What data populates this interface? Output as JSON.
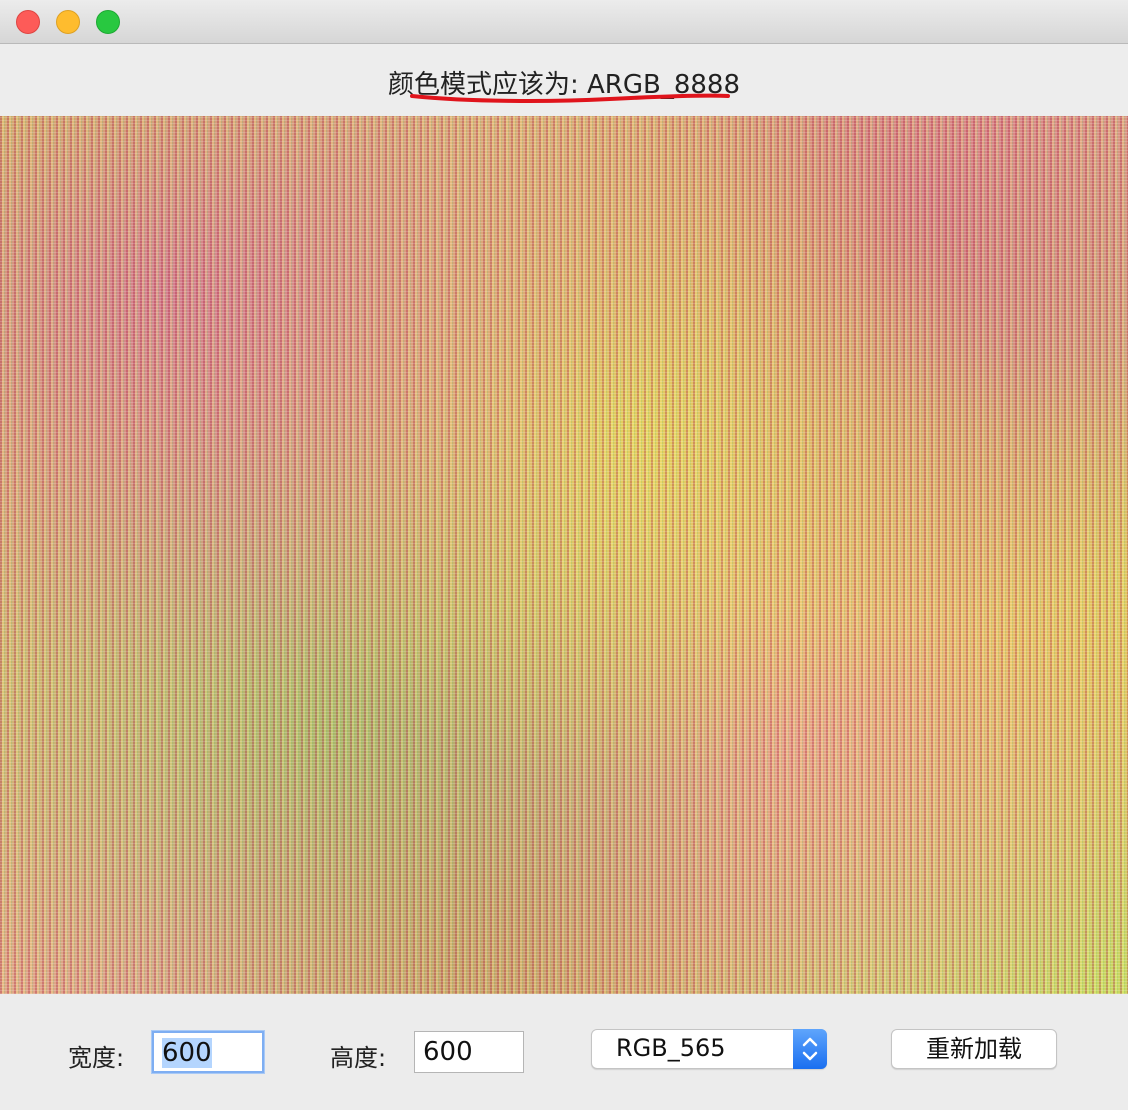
{
  "window": {
    "title": ""
  },
  "heading": {
    "text": "颜色模式应该为: ARGB_8888",
    "underline_color": "#e0141c"
  },
  "image": {
    "description_icon": "image-icon"
  },
  "controls": {
    "width_label": "宽度:",
    "width_value": "600",
    "height_label": "高度:",
    "height_value": "600",
    "color_mode": {
      "selected": "RGB_565"
    },
    "reload_button": "重新加载"
  },
  "colors": {
    "accent": "#1a6ff0",
    "close": "#fd5b58",
    "minimize": "#febc2e",
    "maximize": "#28c840"
  }
}
